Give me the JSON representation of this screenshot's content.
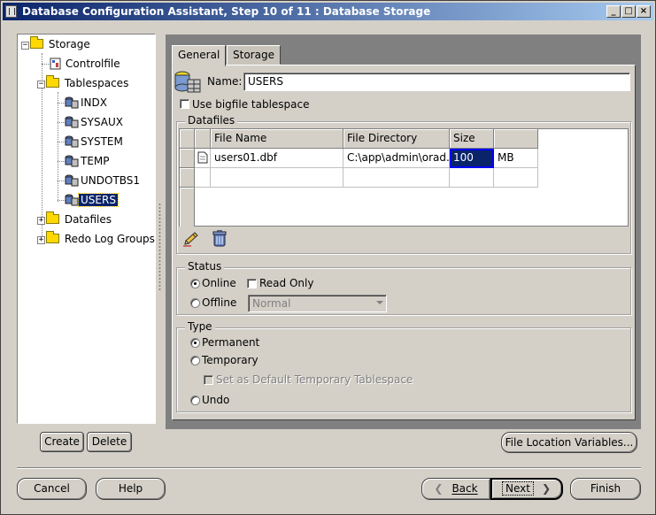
{
  "window": {
    "title": "Database Configuration Assistant, Step 10 of 11 : Database Storage",
    "controls": {
      "minimize": "_",
      "maximize": "□",
      "close": "×"
    }
  },
  "tree": {
    "root": "Storage",
    "controlfile": "Controlfile",
    "tablespaces": "Tablespaces",
    "tablespace_items": [
      "INDX",
      "SYSAUX",
      "SYSTEM",
      "TEMP",
      "UNDOTBS1",
      "USERS"
    ],
    "datafiles": "Datafiles",
    "redo_log_groups": "Redo Log Groups",
    "selected": "USERS"
  },
  "tabs": {
    "general": "General",
    "storage": "Storage",
    "active": "General"
  },
  "general": {
    "name_label": "Name:",
    "name_value": "USERS",
    "bigfile_label": "Use bigfile tablespace",
    "bigfile_checked": false
  },
  "datafiles": {
    "group_title": "Datafiles",
    "columns": [
      "File Name",
      "File Directory",
      "Size",
      ""
    ],
    "rows": [
      {
        "file_name": "users01.dbf",
        "file_directory": "C:\\app\\admin\\orad...",
        "size": "100",
        "unit": "MB"
      }
    ],
    "edit_icon": "pencil-icon",
    "delete_icon": "trash-icon"
  },
  "status": {
    "group_title": "Status",
    "online_label": "Online",
    "read_only_label": "Read Only",
    "offline_label": "Offline",
    "offline_mode_value": "Normal",
    "selected": "Online"
  },
  "type": {
    "group_title": "Type",
    "permanent_label": "Permanent",
    "temporary_label": "Temporary",
    "default_temp_label": "Set as Default Temporary Tablespace",
    "undo_label": "Undo",
    "selected": "Permanent"
  },
  "actions": {
    "create": "Create",
    "delete": "Delete",
    "file_location_variables": "File Location Variables..."
  },
  "footer": {
    "cancel": "Cancel",
    "help": "Help",
    "back": "Back",
    "next": "Next",
    "finish": "Finish"
  },
  "colors": {
    "selection": "#0a246a",
    "title_start": "#0a246a",
    "title_end": "#a6caf0",
    "panel": "#808080"
  }
}
